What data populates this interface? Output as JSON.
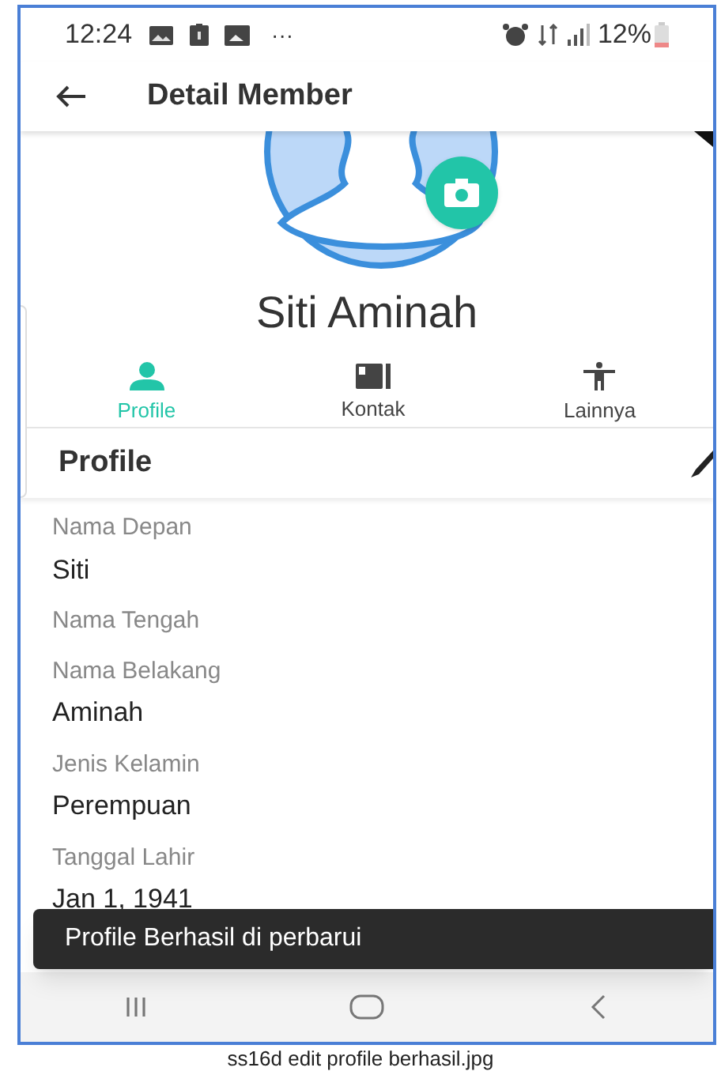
{
  "status_bar": {
    "time": "12:24",
    "overflow": "···",
    "battery": "12%"
  },
  "app_bar": {
    "title": "Detail Member"
  },
  "member": {
    "name": "Siti Aminah"
  },
  "tabs": [
    {
      "label": "Profile",
      "selected": true
    },
    {
      "label": "Kontak",
      "selected": false
    },
    {
      "label": "Lainnya",
      "selected": false
    }
  ],
  "section": {
    "title": "Profile"
  },
  "fields": [
    {
      "label": "Nama Depan",
      "value": "Siti"
    },
    {
      "label": "Nama Tengah"
    },
    {
      "label": "Nama Belakang",
      "value": "Aminah"
    },
    {
      "label": "Jenis Kelamin",
      "value": "Perempuan"
    },
    {
      "label": "Tanggal Lahir",
      "value": "Jan 1, 1941"
    }
  ],
  "snackbar": {
    "message": "Profile Berhasil di perbarui"
  },
  "caption": "ss16d edit profile berhasil.jpg"
}
